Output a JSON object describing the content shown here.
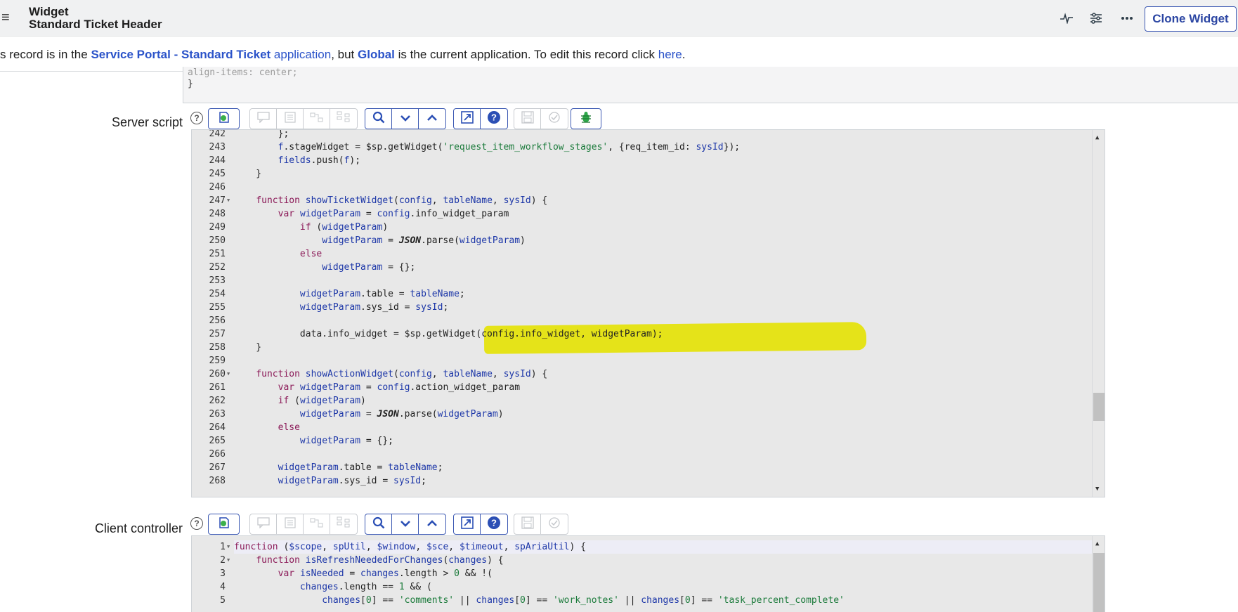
{
  "header": {
    "menu_icon": "hamburger-menu-icon",
    "title_line1": "Widget",
    "title_line2": "Standard Ticket Header",
    "icons": [
      "activity-icon",
      "sliders-icon",
      "more-options-icon"
    ],
    "clone_label": "Clone Widget"
  },
  "notice": {
    "prefix": "s record is in the ",
    "app_link": "Service Portal - Standard Ticket",
    "app_word": " application",
    "middle": ", but ",
    "current_app": "Global",
    "suffix": " is the current application. To edit this record click ",
    "here": "here",
    "period": "."
  },
  "css_tail": {
    "line1": "  align-items: center;",
    "line2": "}"
  },
  "server_script": {
    "label": "Server script",
    "lines": [
      {
        "n": "242",
        "fold": false
      },
      {
        "n": "243",
        "fold": false
      },
      {
        "n": "244",
        "fold": false
      },
      {
        "n": "245",
        "fold": false
      },
      {
        "n": "246",
        "fold": false
      },
      {
        "n": "247",
        "fold": true
      },
      {
        "n": "248",
        "fold": false
      },
      {
        "n": "249",
        "fold": false
      },
      {
        "n": "250",
        "fold": false
      },
      {
        "n": "251",
        "fold": false
      },
      {
        "n": "252",
        "fold": false
      },
      {
        "n": "253",
        "fold": false
      },
      {
        "n": "254",
        "fold": false
      },
      {
        "n": "255",
        "fold": false
      },
      {
        "n": "256",
        "fold": false
      },
      {
        "n": "257",
        "fold": false
      },
      {
        "n": "258",
        "fold": false
      },
      {
        "n": "259",
        "fold": false
      },
      {
        "n": "260",
        "fold": true
      },
      {
        "n": "261",
        "fold": false
      },
      {
        "n": "262",
        "fold": false
      },
      {
        "n": "263",
        "fold": false
      },
      {
        "n": "264",
        "fold": false
      },
      {
        "n": "265",
        "fold": false
      },
      {
        "n": "266",
        "fold": false
      },
      {
        "n": "267",
        "fold": false
      },
      {
        "n": "268",
        "fold": false
      }
    ],
    "code": [
      [
        [
          "",
          "        };"
        ]
      ],
      [
        [
          "",
          "        "
        ],
        [
          "vr",
          "f"
        ],
        [
          "",
          ".stageWidget = $sp.getWidget("
        ],
        [
          "st",
          "'request_item_workflow_stages'"
        ],
        [
          "",
          ", {req_item_id: "
        ],
        [
          "vr",
          "sysId"
        ],
        [
          "",
          "});"
        ]
      ],
      [
        [
          "",
          "        "
        ],
        [
          "vr",
          "fields"
        ],
        [
          "",
          ".push("
        ],
        [
          "vr",
          "f"
        ],
        [
          "",
          ");"
        ]
      ],
      [
        [
          "",
          "    }"
        ]
      ],
      [
        [
          "",
          ""
        ]
      ],
      [
        [
          "",
          "    "
        ],
        [
          "kw",
          "function"
        ],
        [
          "",
          " "
        ],
        [
          "vr",
          "showTicketWidget"
        ],
        [
          "",
          "("
        ],
        [
          "vr",
          "config"
        ],
        [
          "",
          ", "
        ],
        [
          "vr",
          "tableName"
        ],
        [
          "",
          ", "
        ],
        [
          "vr",
          "sysId"
        ],
        [
          "",
          ") {"
        ]
      ],
      [
        [
          "",
          "        "
        ],
        [
          "kw",
          "var"
        ],
        [
          "",
          " "
        ],
        [
          "vr",
          "widgetParam"
        ],
        [
          "",
          " = "
        ],
        [
          "vr",
          "config"
        ],
        [
          "",
          ".info_widget_param"
        ]
      ],
      [
        [
          "",
          "            "
        ],
        [
          "kw",
          "if"
        ],
        [
          "",
          " ("
        ],
        [
          "vr",
          "widgetParam"
        ],
        [
          "",
          ")"
        ]
      ],
      [
        [
          "",
          "                "
        ],
        [
          "vr",
          "widgetParam"
        ],
        [
          "",
          " = "
        ],
        [
          "ob",
          "JSON"
        ],
        [
          "",
          ".parse("
        ],
        [
          "vr",
          "widgetParam"
        ],
        [
          "",
          ")"
        ]
      ],
      [
        [
          "",
          "            "
        ],
        [
          "kw",
          "else"
        ]
      ],
      [
        [
          "",
          "                "
        ],
        [
          "vr",
          "widgetParam"
        ],
        [
          "",
          " = {};"
        ]
      ],
      [
        [
          "",
          ""
        ]
      ],
      [
        [
          "",
          "            "
        ],
        [
          "vr",
          "widgetParam"
        ],
        [
          "",
          ".table = "
        ],
        [
          "vr",
          "tableName"
        ],
        [
          "",
          ";"
        ]
      ],
      [
        [
          "",
          "            "
        ],
        [
          "vr",
          "widgetParam"
        ],
        [
          "",
          ".sys_id = "
        ],
        [
          "vr",
          "sysId"
        ],
        [
          "",
          ";"
        ]
      ],
      [
        [
          "",
          ""
        ]
      ],
      [
        [
          "",
          "            data.info_widget = $sp.getWidget(config.info_widget, widgetParam);"
        ]
      ],
      [
        [
          "",
          "    }"
        ]
      ],
      [
        [
          "",
          ""
        ]
      ],
      [
        [
          "",
          "    "
        ],
        [
          "kw",
          "function"
        ],
        [
          "",
          " "
        ],
        [
          "vr",
          "showActionWidget"
        ],
        [
          "",
          "("
        ],
        [
          "vr",
          "config"
        ],
        [
          "",
          ", "
        ],
        [
          "vr",
          "tableName"
        ],
        [
          "",
          ", "
        ],
        [
          "vr",
          "sysId"
        ],
        [
          "",
          ") {"
        ]
      ],
      [
        [
          "",
          "        "
        ],
        [
          "kw",
          "var"
        ],
        [
          "",
          " "
        ],
        [
          "vr",
          "widgetParam"
        ],
        [
          "",
          " = "
        ],
        [
          "vr",
          "config"
        ],
        [
          "",
          ".action_widget_param"
        ]
      ],
      [
        [
          "",
          "        "
        ],
        [
          "kw",
          "if"
        ],
        [
          "",
          " ("
        ],
        [
          "vr",
          "widgetParam"
        ],
        [
          "",
          ")"
        ]
      ],
      [
        [
          "",
          "            "
        ],
        [
          "vr",
          "widgetParam"
        ],
        [
          "",
          " = "
        ],
        [
          "ob",
          "JSON"
        ],
        [
          "",
          ".parse("
        ],
        [
          "vr",
          "widgetParam"
        ],
        [
          "",
          ")"
        ]
      ],
      [
        [
          "",
          "        "
        ],
        [
          "kw",
          "else"
        ]
      ],
      [
        [
          "",
          "            "
        ],
        [
          "vr",
          "widgetParam"
        ],
        [
          "",
          " = {};"
        ]
      ],
      [
        [
          "",
          ""
        ]
      ],
      [
        [
          "",
          "        "
        ],
        [
          "vr",
          "widgetParam"
        ],
        [
          "",
          ".table = "
        ],
        [
          "vr",
          "tableName"
        ],
        [
          "",
          ";"
        ]
      ],
      [
        [
          "",
          "        "
        ],
        [
          "vr",
          "widgetParam"
        ],
        [
          "",
          ".sys_id = "
        ],
        [
          "vr",
          "sysId"
        ],
        [
          "",
          ";"
        ]
      ]
    ]
  },
  "client_controller": {
    "label": "Client controller",
    "lines": [
      {
        "n": "1",
        "fold": true
      },
      {
        "n": "2",
        "fold": true
      },
      {
        "n": "3",
        "fold": false
      },
      {
        "n": "4",
        "fold": false
      },
      {
        "n": "5",
        "fold": false
      }
    ],
    "code": [
      [
        [
          "kw",
          "function"
        ],
        [
          "",
          " ("
        ],
        [
          "vr",
          "$scope"
        ],
        [
          "",
          ", "
        ],
        [
          "vr",
          "spUtil"
        ],
        [
          "",
          ", "
        ],
        [
          "vr",
          "$window"
        ],
        [
          "",
          ", "
        ],
        [
          "vr",
          "$sce"
        ],
        [
          "",
          ", "
        ],
        [
          "vr",
          "$timeout"
        ],
        [
          "",
          ", "
        ],
        [
          "vr",
          "spAriaUtil"
        ],
        [
          "",
          ") {"
        ]
      ],
      [
        [
          "",
          "    "
        ],
        [
          "kw",
          "function"
        ],
        [
          "",
          " "
        ],
        [
          "vr",
          "isRefreshNeededForChanges"
        ],
        [
          "",
          "("
        ],
        [
          "vr",
          "changes"
        ],
        [
          "",
          ") {"
        ]
      ],
      [
        [
          "",
          "        "
        ],
        [
          "kw",
          "var"
        ],
        [
          "",
          " "
        ],
        [
          "vr",
          "isNeeded"
        ],
        [
          "",
          " = "
        ],
        [
          "vr",
          "changes"
        ],
        [
          "",
          ".length > "
        ],
        [
          "nm",
          "0"
        ],
        [
          "",
          " && !("
        ]
      ],
      [
        [
          "",
          "            "
        ],
        [
          "vr",
          "changes"
        ],
        [
          "",
          ".length == "
        ],
        [
          "nm",
          "1"
        ],
        [
          "",
          " && ("
        ]
      ],
      [
        [
          "",
          "                "
        ],
        [
          "vr",
          "changes"
        ],
        [
          "",
          "["
        ],
        [
          "nm",
          "0"
        ],
        [
          "",
          "] == "
        ],
        [
          "st",
          "'comments'"
        ],
        [
          "",
          " || "
        ],
        [
          "vr",
          "changes"
        ],
        [
          "",
          "["
        ],
        [
          "nm",
          "0"
        ],
        [
          "",
          "] == "
        ],
        [
          "st",
          "'work_notes'"
        ],
        [
          "",
          " || "
        ],
        [
          "vr",
          "changes"
        ],
        [
          "",
          "["
        ],
        [
          "nm",
          "0"
        ],
        [
          "",
          "] == "
        ],
        [
          "st",
          "'task_percent_complete'"
        ]
      ]
    ]
  },
  "toolbar": {
    "help": "?",
    "icons": [
      "script-include-icon",
      "comment-icon",
      "format-icon",
      "replace-icon",
      "replace-all-icon",
      "search-icon",
      "find-next-icon",
      "find-previous-icon",
      "fullscreen-icon",
      "help-icon",
      "save-icon",
      "scripting-assistance-icon",
      "debug-icon"
    ]
  },
  "colors": {
    "accent": "#3c59b3",
    "highlight": "#e5e30e",
    "keyword": "#8b1a58",
    "variable": "#1d37a8",
    "string": "#1a7a3a"
  }
}
